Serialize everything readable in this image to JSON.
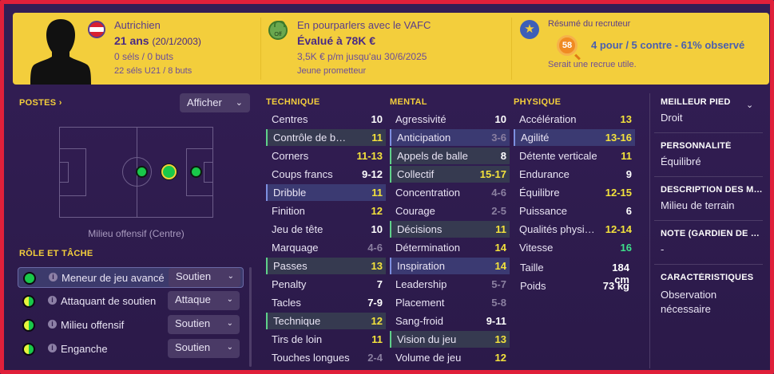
{
  "header": {
    "nationality": "Autrichien",
    "age": "21 ans",
    "dob": "(20/1/2003)",
    "caps": "0 séls / 0 buts",
    "u21": "22 séls U21 / 8 buts",
    "transfer_status": "En pourparlers avec le VAFC",
    "transfer_badge": "Off",
    "value": "Évalué à 78K €",
    "wage": "3,5K € p/m jusqu'au 30/6/2025",
    "potential": "Jeune prometteur",
    "recruiter_title": "Résumé du recruteur",
    "recruiter_score": "58",
    "recruiter_obs": "4 pour / 5 contre - 61% observé",
    "recruiter_note": "Serait une recrue utile.",
    "flag_icon": "austria-flag-icon",
    "accent_color": "#f3ce3c"
  },
  "positions": {
    "title": "POSTES",
    "arrow": "›",
    "filter_label": "Afficher",
    "position_label": "Milieu offensif (Centre)"
  },
  "roles": {
    "title": "RÔLE ET TÂCHE",
    "items": [
      {
        "name": "Meneur de jeu avancé",
        "duty": "Soutien",
        "level": "full"
      },
      {
        "name": "Attaquant de soutien",
        "duty": "Attaque",
        "level": "half"
      },
      {
        "name": "Milieu offensif",
        "duty": "Soutien",
        "level": "half"
      },
      {
        "name": "Enganche",
        "duty": "Soutien",
        "level": "half"
      }
    ]
  },
  "technique": {
    "title": "TECHNIQUE",
    "items": [
      {
        "name": "Centres",
        "value": "10",
        "color": "white",
        "hl": ""
      },
      {
        "name": "Contrôle de balle",
        "value": "11",
        "color": "yellow",
        "hl": "hlg"
      },
      {
        "name": "Corners",
        "value": "11-13",
        "color": "yellow",
        "hl": ""
      },
      {
        "name": "Coups francs",
        "value": "9-12",
        "color": "white",
        "hl": ""
      },
      {
        "name": "Dribble",
        "value": "11",
        "color": "yellow",
        "hl": "hl"
      },
      {
        "name": "Finition",
        "value": "12",
        "color": "yellow",
        "hl": ""
      },
      {
        "name": "Jeu de tête",
        "value": "10",
        "color": "white",
        "hl": ""
      },
      {
        "name": "Marquage",
        "value": "4-6",
        "color": "grey",
        "hl": ""
      },
      {
        "name": "Passes",
        "value": "13",
        "color": "yellow",
        "hl": "hlg"
      },
      {
        "name": "Penalty",
        "value": "7",
        "color": "white",
        "hl": ""
      },
      {
        "name": "Tacles",
        "value": "7-9",
        "color": "white",
        "hl": ""
      },
      {
        "name": "Technique",
        "value": "12",
        "color": "yellow",
        "hl": "hlg"
      },
      {
        "name": "Tirs de loin",
        "value": "11",
        "color": "yellow",
        "hl": ""
      },
      {
        "name": "Touches longues",
        "value": "2-4",
        "color": "grey",
        "hl": ""
      }
    ]
  },
  "mental": {
    "title": "MENTAL",
    "items": [
      {
        "name": "Agressivité",
        "value": "10",
        "color": "white",
        "hl": ""
      },
      {
        "name": "Anticipation",
        "value": "3-6",
        "color": "grey",
        "hl": "hl"
      },
      {
        "name": "Appels de balle",
        "value": "8",
        "color": "white",
        "hl": "hlg"
      },
      {
        "name": "Collectif",
        "value": "15-17",
        "color": "yellow",
        "hl": "hlg"
      },
      {
        "name": "Concentration",
        "value": "4-6",
        "color": "grey",
        "hl": ""
      },
      {
        "name": "Courage",
        "value": "2-5",
        "color": "grey",
        "hl": ""
      },
      {
        "name": "Décisions",
        "value": "11",
        "color": "yellow",
        "hl": "hlg"
      },
      {
        "name": "Détermination",
        "value": "14",
        "color": "yellow",
        "hl": ""
      },
      {
        "name": "Inspiration",
        "value": "14",
        "color": "yellow",
        "hl": "hl"
      },
      {
        "name": "Leadership",
        "value": "5-7",
        "color": "grey",
        "hl": ""
      },
      {
        "name": "Placement",
        "value": "5-8",
        "color": "grey",
        "hl": ""
      },
      {
        "name": "Sang-froid",
        "value": "9-11",
        "color": "white",
        "hl": ""
      },
      {
        "name": "Vision du jeu",
        "value": "13",
        "color": "yellow",
        "hl": "hlg"
      },
      {
        "name": "Volume de jeu",
        "value": "12",
        "color": "yellow",
        "hl": ""
      }
    ]
  },
  "physique": {
    "title": "PHYSIQUE",
    "items": [
      {
        "name": "Accélération",
        "value": "13",
        "color": "yellow",
        "hl": ""
      },
      {
        "name": "Agilité",
        "value": "13-16",
        "color": "yellow",
        "hl": "hl"
      },
      {
        "name": "Détente verticale",
        "value": "11",
        "color": "yellow",
        "hl": ""
      },
      {
        "name": "Endurance",
        "value": "9",
        "color": "white",
        "hl": ""
      },
      {
        "name": "Équilibre",
        "value": "12-15",
        "color": "yellow",
        "hl": ""
      },
      {
        "name": "Puissance",
        "value": "6",
        "color": "white",
        "hl": ""
      },
      {
        "name": "Qualités physiques",
        "value": "12-14",
        "color": "yellow",
        "hl": ""
      },
      {
        "name": "Vitesse",
        "value": "16",
        "color": "green",
        "hl": ""
      }
    ],
    "height_label": "Taille",
    "height_value": "184 cm",
    "weight_label": "Poids",
    "weight_value": "73 kg"
  },
  "info": {
    "foot_label": "MEILLEUR PIED",
    "foot_value": "Droit",
    "personality_label": "PERSONNALITÉ",
    "personality_value": "Équilibré",
    "desc_label": "DESCRIPTION DES MÉDIAS",
    "desc_value": "Milieu de terrain",
    "gk_label": "NOTE (GARDIEN DE BUT)",
    "gk_value": "-",
    "traits_label": "CARACTÉRISTIQUES",
    "traits_value": "Observation nécessaire"
  }
}
